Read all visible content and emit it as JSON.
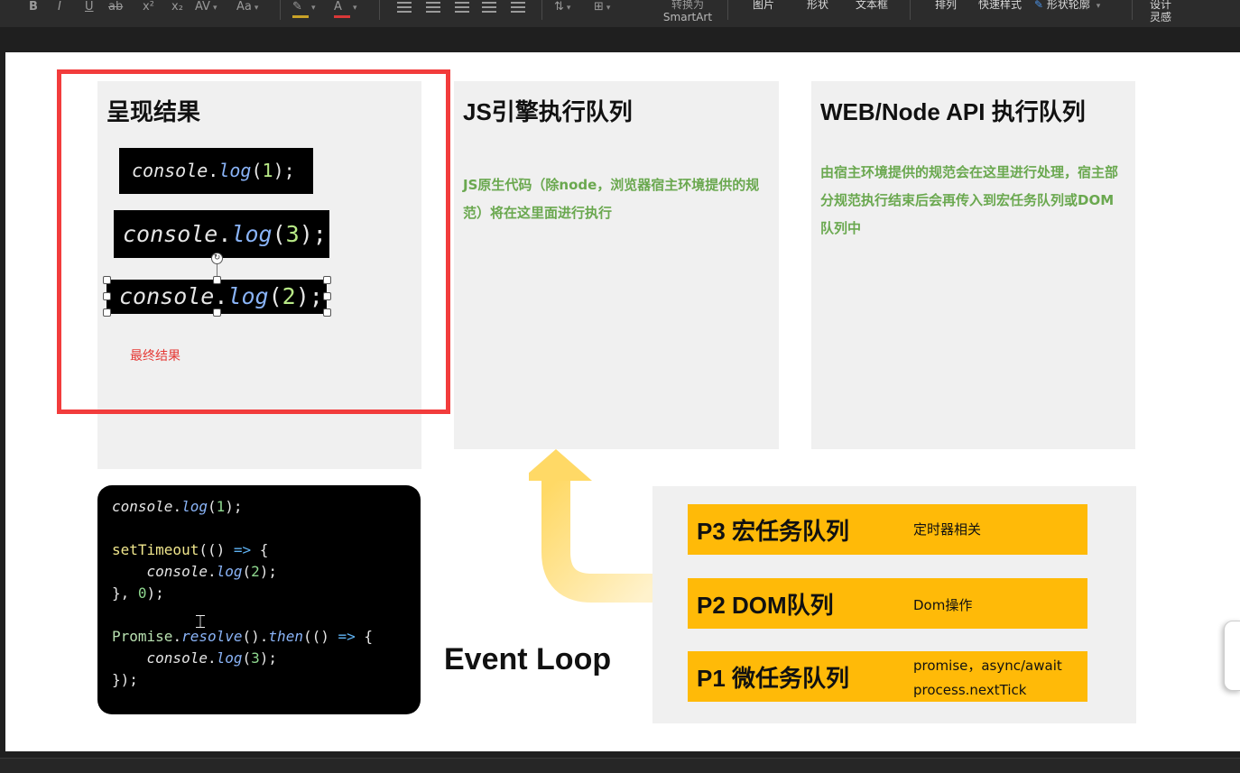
{
  "toolbar": {
    "format_buttons": [
      "B",
      "I",
      "U",
      "ab",
      "x²",
      "x₂",
      "AV",
      "Aa"
    ],
    "highlight_color": "#c9a227",
    "font_color": "#d93838",
    "convert_smartart_line1": "转换为",
    "convert_smartart_line2": "SmartArt",
    "picture": "图片",
    "shape": "形状",
    "textbox": "文本框",
    "arrange": "排列",
    "quick_styles": "快速样式",
    "shape_outline": "形状轮廓",
    "design_ideas_line1": "设计",
    "design_ideas_line2": "灵感"
  },
  "slide": {
    "panel_result": {
      "title": "呈现结果",
      "caption": "最终结果",
      "lines": [
        {
          "obj": "console",
          "dot": ".",
          "fn": "log",
          "open": "(",
          "arg": "1",
          "close": ");"
        },
        {
          "obj": "console",
          "dot": ".",
          "fn": "log",
          "open": "(",
          "arg": "3",
          "close": ");"
        },
        {
          "obj": "console",
          "dot": ".",
          "fn": "log",
          "open": "(",
          "arg": "2",
          "close": ");"
        }
      ]
    },
    "panel_js": {
      "title": "JS引擎执行队列",
      "desc": "JS原生代码（除node，浏览器宿主环境提供的规范）将在这里面进行执行"
    },
    "panel_web": {
      "title": "WEB/Node API 执行队列",
      "desc": "由宿主环境提供的规范会在这里进行处理，宿主部分规范执行结束后会再传入到宏任务队列或DOM队列中"
    },
    "code": {
      "l1_obj": "console",
      "l1_dot": ".",
      "l1_fn": "log",
      "l1_open": "(",
      "l1_arg": "1",
      "l1_close": ");",
      "l3_fn": "setTimeout",
      "l3_open": "(() ",
      "l3_arrow": "=>",
      "l3_brace": " {",
      "l4_obj": "console",
      "l4_dot": ".",
      "l4_fn": "log",
      "l4_open": "(",
      "l4_arg": "2",
      "l4_close": ");",
      "l5_a": "}, ",
      "l5_num": "0",
      "l5_b": ");",
      "l7_obj": "Promise",
      "l7_dot": ".",
      "l7_fn": "resolve",
      "l7_mid": "().",
      "l7_fn2": "then",
      "l7_open": "(() ",
      "l7_arrow": "=>",
      "l7_brace": " {",
      "l8_obj": "console",
      "l8_dot": ".",
      "l8_fn": "log",
      "l8_open": "(",
      "l8_arg": "3",
      "l8_close": ");",
      "l9": "});"
    },
    "event_loop_label": "Event Loop",
    "queues": [
      {
        "name": "P3 宏任务队列",
        "note": "定时器相关",
        "note2": ""
      },
      {
        "name": "P2 DOM队列",
        "note": "Dom操作",
        "note2": ""
      },
      {
        "name": "P1 微任务队列",
        "note": "promise，async/await",
        "note2": "process.nextTick"
      }
    ],
    "colors": {
      "frame_red": "#f23c3c",
      "queue_yellow": "#ffba08",
      "desc_green": "#6aa84f",
      "arrow_yellow": "#ffe39a",
      "panel_gray": "#f0f0f0"
    }
  }
}
